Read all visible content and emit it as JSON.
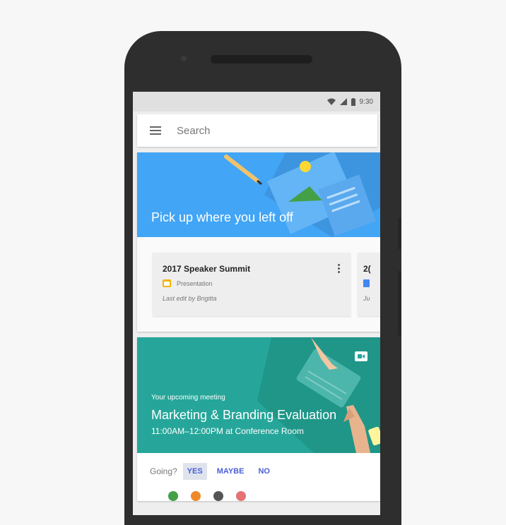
{
  "status_bar": {
    "time": "9:30"
  },
  "search": {
    "label": "Search"
  },
  "card_continue": {
    "title": "Pick up where you left off",
    "documents": [
      {
        "title": "2017 Speaker Summit",
        "type": "Presentation",
        "last_edit": "Last edit by Brigitta"
      },
      {
        "title": "2(",
        "last_edit": "Ju"
      }
    ]
  },
  "card_meeting": {
    "subtitle": "Your upcoming meeting",
    "title": "Marketing & Branding Evaluation",
    "time": "11:00AM–12:00PM at Conference Room",
    "going_label": "Going?",
    "options": [
      "YES",
      "MAYBE",
      "NO"
    ]
  },
  "colors": {
    "blue_banner": "#42a5f5",
    "teal_banner": "#26a69a",
    "accent": "#4a5fd6"
  }
}
